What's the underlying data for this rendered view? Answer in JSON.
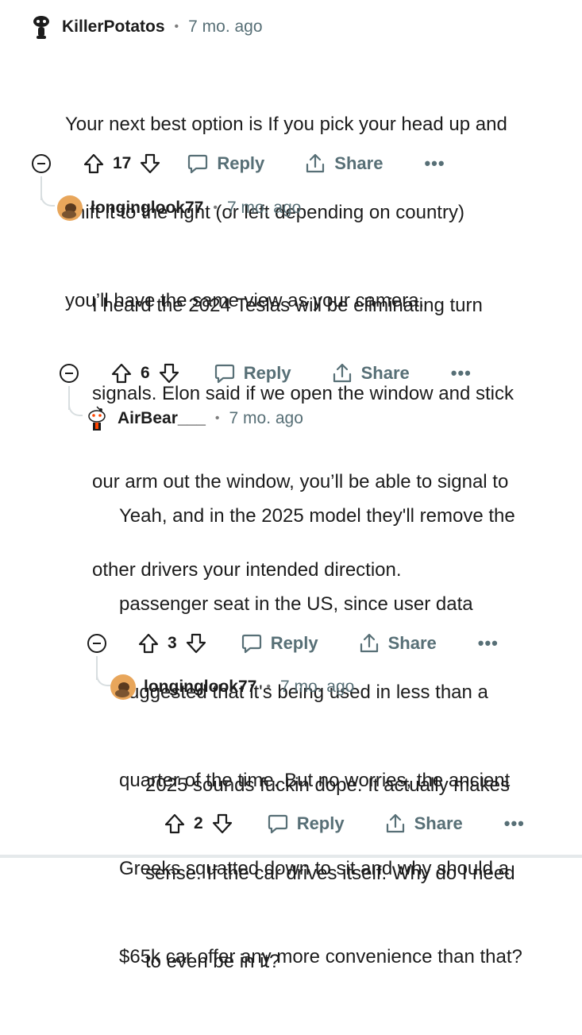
{
  "comments": [
    {
      "username": "KillerPotatos",
      "age": "7 mo. ago",
      "avatar_icon": "snoo-dark-avatar",
      "lines": [
        "Your next best option is If you pick your head up and",
        "shift it to the right (or left depending on country)",
        "you’ll have the same view as your camera."
      ],
      "votes": "17",
      "reply_label": "Reply",
      "share_label": "Share",
      "more_label": "•••"
    },
    {
      "username": "longinglook77",
      "age": "7 mo. ago",
      "avatar_icon": "orange-avatar",
      "lines": [
        "I heard the 2024 Teslas will be eliminating turn",
        "signals. Elon said if we open the window and stick",
        "our arm out the window, you’ll be able to signal to",
        "other drivers your intended direction."
      ],
      "votes": "6",
      "reply_label": "Reply",
      "share_label": "Share",
      "more_label": "•••"
    },
    {
      "username": "AirBear___",
      "age": "7 mo. ago",
      "avatar_icon": "snoo-avatar",
      "lines": [
        "Yeah, and in the 2025 model they'll remove the",
        "passenger seat in the US, since user data",
        "suggested that it's being used in less than a",
        "quarter of the time. But no worries, the ancient",
        "Greeks squatted down to sit and why should a",
        "$65k car offer any more convenience than that?"
      ],
      "votes": "3",
      "reply_label": "Reply",
      "share_label": "Share",
      "more_label": "•••"
    },
    {
      "username": "longinglook77",
      "age": "7 mo. ago",
      "avatar_icon": "orange-avatar",
      "lines": [
        "2025 sounds fuckin dope. It actually makes",
        "sense. If the car drives itself. Why do I need",
        "to even be in it?"
      ],
      "votes": "2",
      "reply_label": "Reply",
      "share_label": "Share",
      "more_label": "•••"
    }
  ],
  "separator": "•",
  "colors": {
    "text": "#1c1c1c",
    "meta": "#576f76",
    "thread_line": "#d8dee0",
    "avatar_orange": "#e8a65b"
  }
}
